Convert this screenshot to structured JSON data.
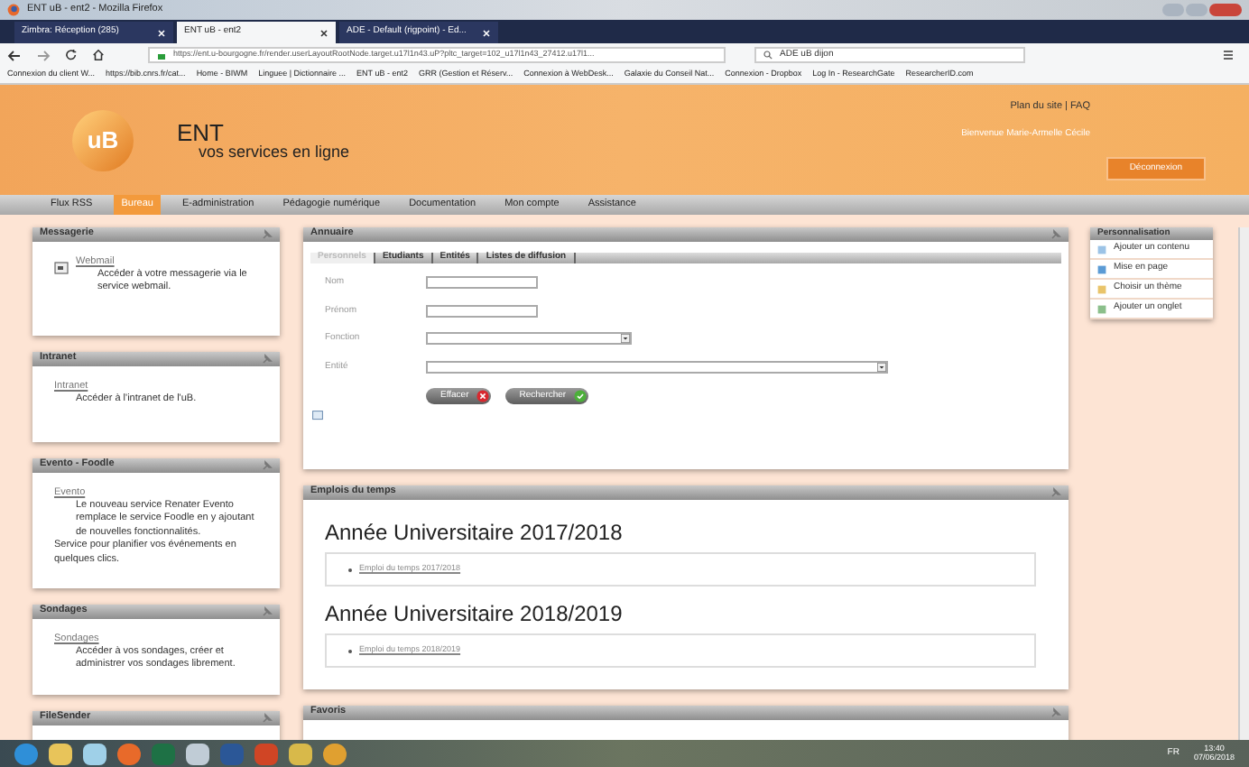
{
  "window": {
    "title": "ENT uB - ent2 - Mozilla Firefox"
  },
  "browser_tabs": [
    {
      "label": "Zimbra: Réception (285)",
      "selected": false
    },
    {
      "label": "ENT uB - ent2",
      "selected": true
    },
    {
      "label": "ADE - Default (rigpoint) - Ed...",
      "selected": false
    }
  ],
  "address_bar": {
    "url": "https://ent.u-bourgogne.fr/render.userLayoutRootNode.target.u17l1n43.uP?pltc_target=102_u17l1n43_27412.u17l1..."
  },
  "search": {
    "value": "ADE uB dijon"
  },
  "bookmarks": [
    "Connexion du client W...",
    "https://bib.cnrs.fr/cat...",
    "Home - BIWM",
    "Linguee | Dictionnaire ...",
    "ENT uB - ent2",
    "GRR (Gestion et Réserv...",
    "Connexion à WebDesk...",
    "Galaxie du Conseil Nat...",
    "Connexion - Dropbox",
    "Log In - ResearchGate",
    "ResearcherID.com"
  ],
  "header": {
    "logo_text": "uB",
    "title": "ENT",
    "subtitle": "vos services en ligne",
    "site_links": "Plan du site | FAQ",
    "welcome": "Bienvenue Marie-Armelle Cécile",
    "logout": "Déconnexion"
  },
  "menu": [
    {
      "label": "Flux RSS",
      "selected": false
    },
    {
      "label": "Bureau",
      "selected": true
    },
    {
      "label": "E-administration",
      "selected": false
    },
    {
      "label": "Pédagogie numérique",
      "selected": false
    },
    {
      "label": "Documentation",
      "selected": false
    },
    {
      "label": "Mon compte",
      "selected": false
    },
    {
      "label": "Assistance",
      "selected": false
    }
  ],
  "left_portlets": [
    {
      "title": "Messagerie",
      "link": "Webmail",
      "text": [
        "Accéder à votre messagerie via le service webmail."
      ]
    },
    {
      "title": "Intranet",
      "link": "Intranet",
      "text": [
        "Accéder à l'intranet de l'uB."
      ]
    },
    {
      "title": "Evento - Foodle",
      "link": "Evento",
      "text": [
        "Le nouveau service Renater Evento remplace le service Foodle en y ajoutant de nouvelles fonctionnalités.",
        "Service pour planifier vos événements en quelques clics."
      ]
    },
    {
      "title": "Sondages",
      "link": "Sondages",
      "text": [
        "Accéder à vos sondages, créer et administrer vos sondages librement."
      ]
    },
    {
      "title": "FileSender"
    }
  ],
  "annuaire": {
    "title": "Annuaire",
    "tabs": [
      {
        "label": "Personnels",
        "selected": true
      },
      {
        "label": "Etudiants",
        "selected": false
      },
      {
        "label": "Entités",
        "selected": false
      },
      {
        "label": "Listes de diffusion",
        "selected": false
      }
    ],
    "fields": [
      {
        "label": "Nom",
        "kind": "text"
      },
      {
        "label": "Prénom",
        "kind": "text"
      },
      {
        "label": "Fonction",
        "kind": "select"
      },
      {
        "label": "Entité",
        "kind": "wide-select"
      }
    ],
    "buttons": [
      {
        "label": "Effacer",
        "kind": "clear"
      },
      {
        "label": "Rechercher",
        "kind": "search"
      }
    ]
  },
  "emplois": {
    "title": "Emplois du temps",
    "years": [
      {
        "heading": "Année Universitaire 2017/2018",
        "link": "Emploi du temps 2017/2018"
      },
      {
        "heading": "Année Universitaire 2018/2019",
        "link": "Emploi du temps 2018/2019"
      }
    ]
  },
  "favoris": {
    "title": "Favoris"
  },
  "personnalisation": {
    "title": "Personnalisation",
    "items": [
      "Ajouter un contenu",
      "Mise en page",
      "Choisir un thème",
      "Ajouter un onglet"
    ]
  },
  "taskbar": {
    "language": "FR",
    "time": "13:40",
    "date": "07/06/2018"
  }
}
